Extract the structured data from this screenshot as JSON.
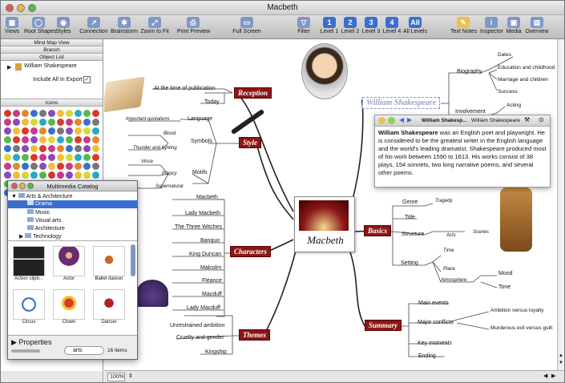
{
  "window": {
    "title": "Macbeth"
  },
  "toolbar": {
    "items": [
      "Views",
      "Root Shapes",
      "Styles",
      "Connection",
      "Brainstorm",
      "Zoom to Fit",
      "Print Preview",
      "Full Screen",
      "Filter",
      "Level 1",
      "Level 2",
      "Level 3",
      "Level 4",
      "All Levels",
      "Text Notes",
      "Inspector",
      "Media",
      "Overview"
    ],
    "level_nums": [
      "1",
      "2",
      "3",
      "4",
      "All"
    ]
  },
  "sidebar": {
    "section_views": "Mind Map View",
    "section_branch": "Branch",
    "section_objects": "Object List",
    "object_item": "William Shakespeare",
    "include_export": "Include All In Export",
    "section_icons": "Icons"
  },
  "catalog": {
    "title": "Multimedia Catalog",
    "tree": [
      "Arts & Architecture",
      "Drama",
      "Music",
      "Visual arts",
      "Architecture",
      "Technology"
    ],
    "thumbs": [
      "Action clipb...",
      "Actor",
      "Ballet dancer",
      "Circus",
      "Clown",
      "Dancer"
    ],
    "properties": "Properties",
    "search_value": "arts",
    "count": "16 items"
  },
  "note": {
    "header_title": "William Shakesp...",
    "header_title2": "William Shakespeare",
    "bold": "William Shakespeare",
    "body": " was an English poet and playwright. He is considered to be the greatest writer in the English language and the world's leading dramatist. Shakespeare produced most of his work between 1590 to 1613. His works consist of 38 plays, 154 sonnets, two long narrative poems, and several other poems."
  },
  "map": {
    "center": "Macbeth",
    "topics": {
      "reception": "Reception",
      "style": "Style",
      "characters": "Characters",
      "themes": "Themes",
      "basics": "Basics",
      "summary": "Summary",
      "shakespeare": "William Shakespeare"
    },
    "reception": [
      "At the time of publication",
      "Today"
    ],
    "style": [
      "Language",
      "Symbols",
      "Motifs"
    ],
    "style_sub": [
      "Important quotations",
      "Blood",
      "Thunder and lighting",
      "Vince",
      "Propcy",
      "Supernatural"
    ],
    "characters": [
      "Macbeth",
      "Lady Macbeth",
      "The Three Witches",
      "Banquo",
      "King Duncan",
      "Malcolm",
      "Fleance",
      "Macduff",
      "Lady Macduff"
    ],
    "themes": [
      "Unrestrained ambition",
      "Cruelty and gender",
      "Kingship"
    ],
    "basics": [
      "Genre",
      "Title",
      "Structure",
      "Setting"
    ],
    "basics_sub": [
      "Tragedy",
      "Acts",
      "Scenes",
      "Time",
      "Place",
      "Atmosphere",
      "Mood",
      "Tone"
    ],
    "summary": [
      "Main events",
      "Major conflicts",
      "Key moments",
      "Ending"
    ],
    "summary_sub": [
      "Ambition versus loyalty",
      "Murderous evil versus guilt"
    ],
    "shakespeare": [
      "Biography",
      "Involvement"
    ],
    "biography": [
      "Dates",
      "Education and childhood",
      "Marriage and children",
      "Success"
    ],
    "involvement": [
      "Acting"
    ]
  },
  "status": {
    "zoom": "100%"
  },
  "colors": {
    "topic": "#8c1616",
    "accent": "#3a6fd0"
  }
}
